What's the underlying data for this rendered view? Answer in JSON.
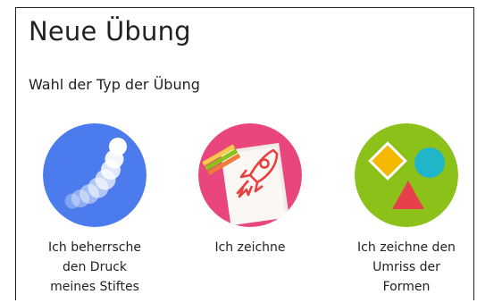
{
  "header": {
    "title": "Neue Übung"
  },
  "main": {
    "subtitle": "Wahl der Typ der Übung",
    "options": [
      {
        "label": "Ich beherrsche\nden Druck\nmeines Stiftes",
        "icon": "pressure-stroke-icon",
        "color": "#4b7bec"
      },
      {
        "label": "Ich zeichne",
        "icon": "rocket-drawing-icon",
        "color": "#e8467c"
      },
      {
        "label": "Ich zeichne den\nUmriss der\nFormen",
        "icon": "shapes-icon",
        "color": "#8cc11a"
      }
    ]
  }
}
